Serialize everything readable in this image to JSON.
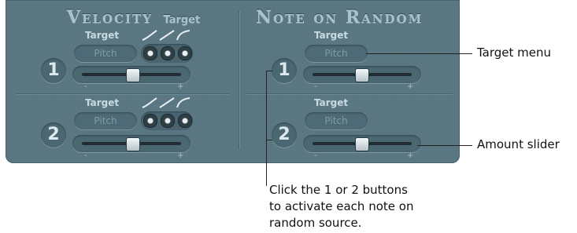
{
  "velocity": {
    "title": "Velocity",
    "subtitle": "Target",
    "rows": [
      {
        "number": "1",
        "target_label": "Target",
        "target_value": "Pitch",
        "minus": "-",
        "plus": "+"
      },
      {
        "number": "2",
        "target_label": "Target",
        "target_value": "Pitch",
        "minus": "-",
        "plus": "+"
      }
    ]
  },
  "note_on_random": {
    "title": "Note on Random",
    "rows": [
      {
        "number": "1",
        "target_label": "Target",
        "target_value": "Pitch",
        "minus": "-",
        "plus": "+"
      },
      {
        "number": "2",
        "target_label": "Target",
        "target_value": "Pitch",
        "minus": "-",
        "plus": "+"
      }
    ]
  },
  "callouts": {
    "target_menu": "Target menu",
    "amount_slider": "Amount slider",
    "buttons_note_line1": "Click the 1 or 2 buttons",
    "buttons_note_line2": "to activate each note on",
    "buttons_note_line3": "random source."
  },
  "colors": {
    "panel": "#5a7783",
    "header": "#a9c3cd",
    "text": "#111111"
  }
}
